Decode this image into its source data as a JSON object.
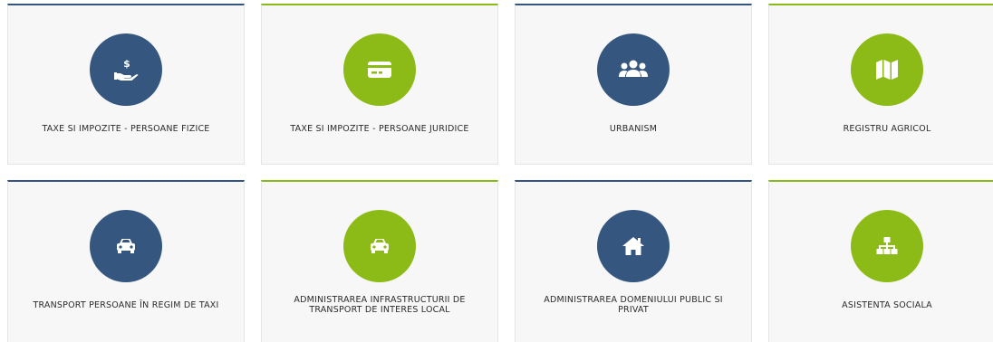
{
  "services": [
    {
      "label": "TAXE SI IMPOZITE - PERSOANE FIZICE",
      "icon": "hand-dollar-icon",
      "color": "#34567f"
    },
    {
      "label": "TAXE SI IMPOZITE - PERSOANE JURIDICE",
      "icon": "credit-card-icon",
      "color": "#8cba16"
    },
    {
      "label": "URBANISM",
      "icon": "users-icon",
      "color": "#34567f"
    },
    {
      "label": "REGISTRU AGRICOL",
      "icon": "map-icon",
      "color": "#8cba16"
    },
    {
      "label": "TRANSPORT PERSOANE ÎN REGIM DE TAXI",
      "icon": "car-icon",
      "color": "#34567f"
    },
    {
      "label": "ADMINISTRAREA INFRASTRUCTURII DE TRANSPORT DE INTERES LOCAL",
      "icon": "car-icon",
      "color": "#8cba16"
    },
    {
      "label": "ADMINISTRAREA DOMENIULUI PUBLIC SI PRIVAT",
      "icon": "home-icon",
      "color": "#34567f"
    },
    {
      "label": "ASISTENTA SOCIALA",
      "icon": "sitemap-icon",
      "color": "#8cba16"
    }
  ]
}
